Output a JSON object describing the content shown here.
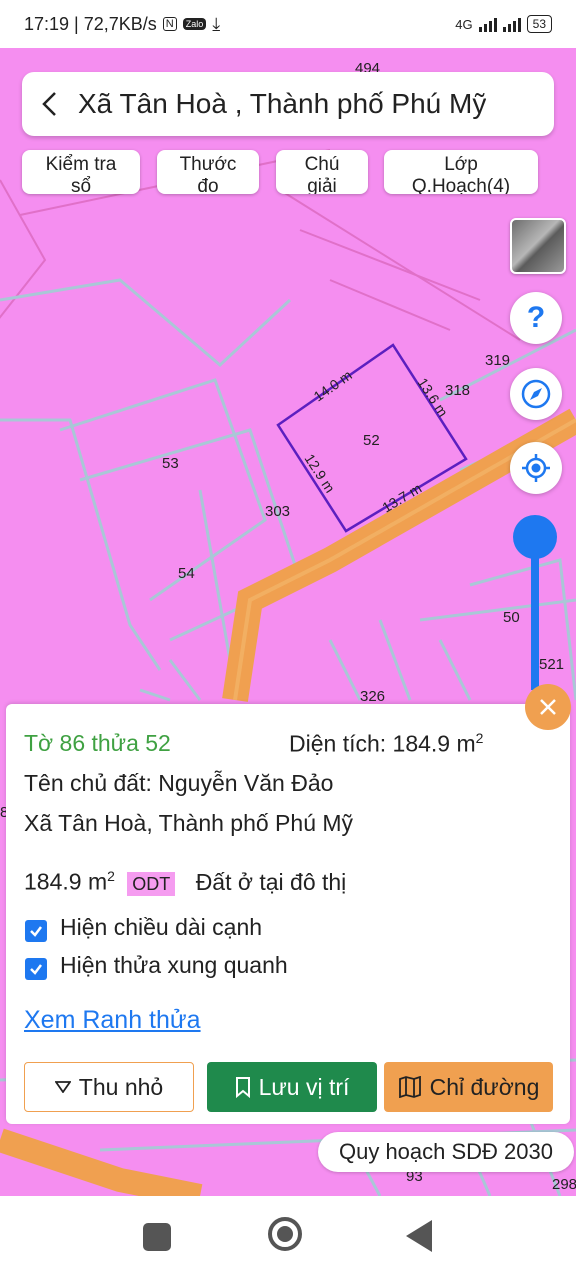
{
  "status_bar": {
    "time_speed": "17:19 | 72,7KB/s",
    "network": "4G",
    "battery": "53"
  },
  "header": {
    "back_icon": "chevron-left-icon",
    "title": "Xã Tân Hoà , Thành phố Phú Mỹ"
  },
  "chips": [
    {
      "line1": "Kiểm tra",
      "line2": "sổ"
    },
    {
      "line1": "Thước",
      "line2": "đo"
    },
    {
      "line1": "Chú",
      "line2": "giải"
    },
    {
      "line1": "Lớp",
      "line2": "Q.Hoạch(4)"
    }
  ],
  "map_labels": {
    "p494": "494",
    "p319": "319",
    "p318": "318",
    "p52": "52",
    "p53": "53",
    "p303": "303",
    "p54": "54",
    "p50": "50",
    "p521": "521",
    "p326": "326",
    "p93": "93",
    "p298": "298",
    "p8": "8",
    "edge_top": "14.0 m",
    "edge_right": "13.6 m",
    "edge_left": "12.9 m",
    "edge_bottom": "13.7 m"
  },
  "colors": {
    "land": "#f58ef0",
    "road": "#f0a050",
    "accent": "#1e78f0",
    "parcel_outline": "#5c1fc0"
  },
  "panel": {
    "sheet_parcel": "Tờ 86 thửa 52",
    "area_label": "Diện tích: 184.9 m",
    "area_sup": "2",
    "owner": "Tên chủ đất: Nguyễn Văn Đảo",
    "address": "Xã Tân Hoà, Thành phố Phú Mỹ",
    "land_area": "184.9 m",
    "land_area_sup": "2",
    "land_code": "ODT",
    "land_type": "Đất ở tại đô thị",
    "checkbox_1": "Hiện chiều dài cạnh",
    "checkbox_2": "Hiện thửa xung quanh",
    "link": "Xem Ranh thửa",
    "btn_shrink": "Thu nhỏ",
    "btn_save": "Lưu vị trí",
    "btn_route": "Chỉ đường"
  },
  "plan_badge": "Quy hoạch SDĐ 2030"
}
